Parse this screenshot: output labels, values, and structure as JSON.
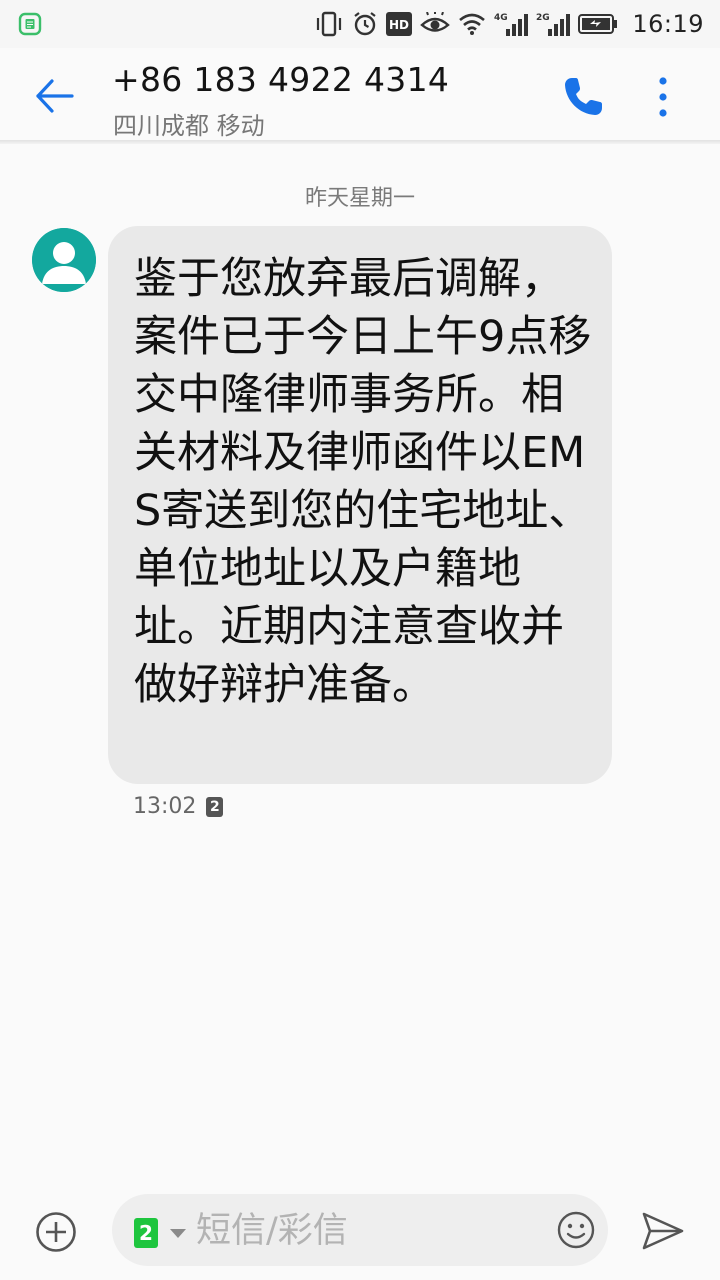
{
  "status_bar": {
    "time": "16:19",
    "network_1": "4G",
    "network_2": "2G",
    "hd_label": "HD"
  },
  "header": {
    "contact_number": "+86 183 4922 4314",
    "contact_location": "四川成都 移动",
    "icons": {
      "back": "arrow-left-icon",
      "call": "phone-icon",
      "more": "more-vertical-icon"
    }
  },
  "conversation": {
    "date_label": "昨天星期一",
    "messages": [
      {
        "text": "鉴于您放弃最后调解，案件已于今日上午9点移交中隆律师事务所。相关材料及律师函件以EMS寄送到您的住宅地址、单位地址以及户籍地址。近期内注意查收并做好辩护准备。",
        "time": "13:02",
        "sim": "2"
      }
    ]
  },
  "composer": {
    "sim_label": "2",
    "placeholder": "短信/彩信",
    "value": "",
    "icons": {
      "add": "add-circle-icon",
      "emoji": "emoji-icon",
      "send": "send-icon"
    }
  },
  "colors": {
    "accent": "#1a73e8",
    "bubble": "#e9e9e9",
    "avatar": "#13a89e",
    "sim_green": "#1ec53e"
  }
}
